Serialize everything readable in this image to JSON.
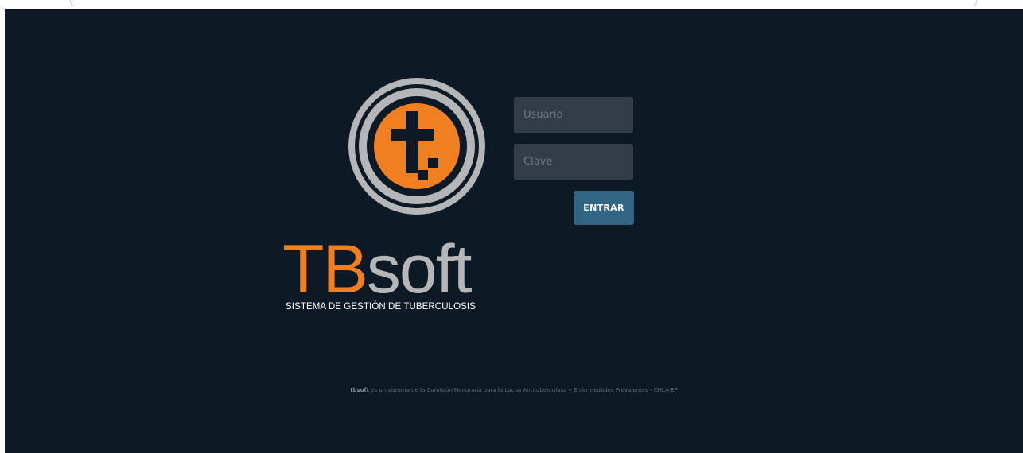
{
  "login": {
    "username_placeholder": "Usuario",
    "password_placeholder": "Clave",
    "submit_label": "ENTRAR"
  },
  "brand": {
    "name_part1": "TB",
    "name_part2": "soft",
    "tagline": "SISTEMA DE GESTIÓN DE TUBERCULOSIS",
    "logo_icon": "tbsoft-circle-t-logo"
  },
  "footer": {
    "brand": "tbsoft",
    "text": " es un sistema de la Comisión Honoraria para la Lucha Antituberculasa y Enfermedades Prevalentes - CHLA-EP"
  },
  "colors": {
    "background": "#0d1a26",
    "accent_orange": "#f07f22",
    "logo_gray": "#b4b6b8",
    "input_bg": "#323d48",
    "button_bg": "#306584"
  }
}
